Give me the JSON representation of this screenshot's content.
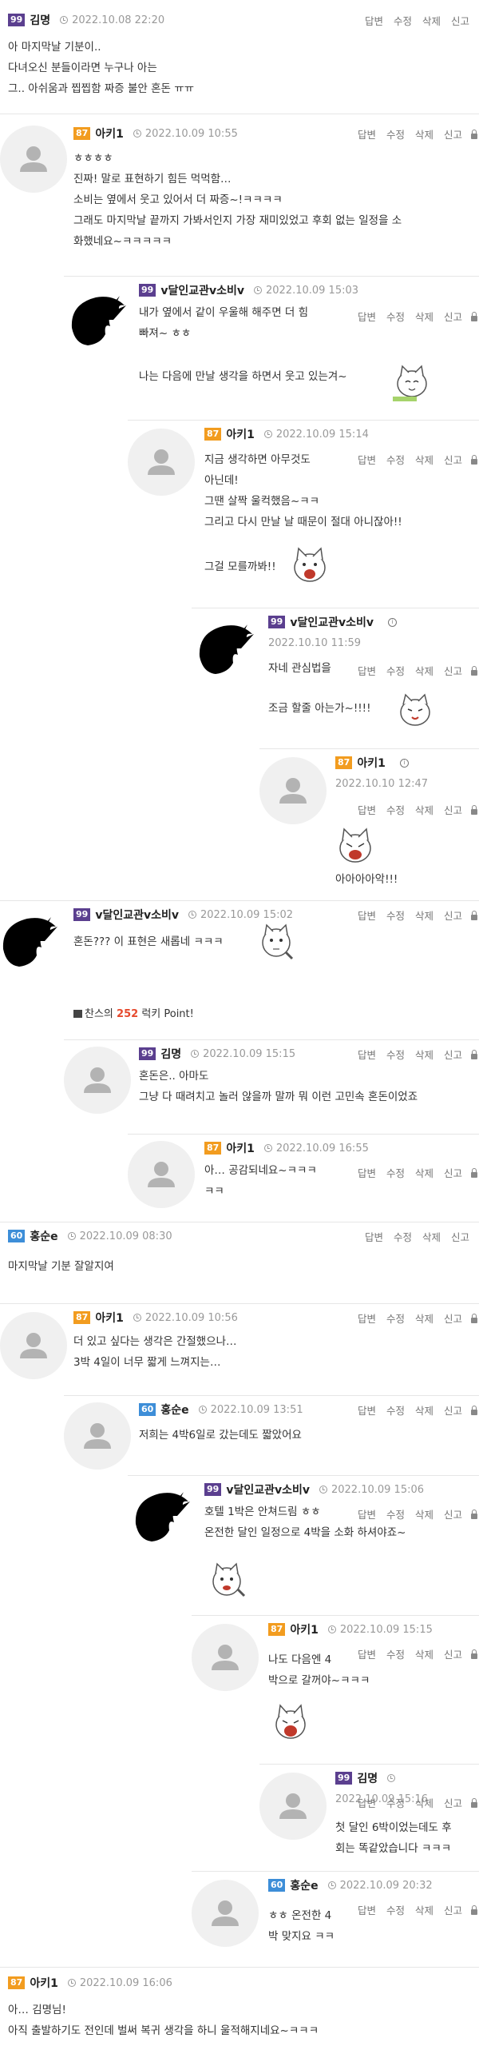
{
  "actions": {
    "reply": "답변",
    "edit": "수정",
    "delete": "삭제",
    "report": "신고"
  },
  "comments": [
    {
      "level": "99",
      "nick": "김명",
      "date": "2022.10.08 22:20",
      "text": "아 마지막날 기분이..\n다녀오신 분들이라면 누구나 아는\n그.. 아쉬움과 찝찝함 짜증 불안 혼돈 ㅠㅠ"
    },
    {
      "level": "87",
      "nick": "아키1",
      "date": "2022.10.09 10:55",
      "text": "ㅎㅎㅎㅎ\n진짜! 말로 표현하기 힘든 먹먹함…\n소비는 옆에서 웃고 있어서 더 짜증~!ㅋㅋㅋㅋ\n그래도 마지막날 끝까지 가봐서인지 가장 재미있었고 후회 없는 일정을 소\n화했네요~ㅋㅋㅋㅋㅋ"
    },
    {
      "level": "99",
      "nick": "v달인교관v소비v",
      "date": "2022.10.09 15:03",
      "text": "내가 옆에서 같이 우울해 해주면 더 힘\n빠져~ ㅎㅎ",
      "text2": "나는 다음에 만날 생각을 하면서 웃고 있는겨~"
    },
    {
      "level": "87",
      "nick": "아키1",
      "date": "2022.10.09 15:14",
      "text": "지금 생각하면 아무것도\n아닌데!\n그땐 살짝 울컥했음~ㅋㅋ\n그리고 다시 만날 날 때문이 절대 아니잖아!!",
      "text2": "그걸 모를까봐!!"
    },
    {
      "level": "99",
      "nick": "v달인교관v소비v",
      "date": "2022.10.10 11:59",
      "text": "자네 관심법을",
      "text2": "조금 할줄 아는가~!!!!"
    },
    {
      "level": "87",
      "nick": "아키1",
      "date": "2022.10.10 12:47",
      "text": "아아아아악!!!"
    },
    {
      "level": "99",
      "nick": "v달인교관v소비v",
      "date": "2022.10.09 15:02",
      "text": "혼돈??? 이 표현은 새롭네 ㅋㅋㅋ",
      "point_prefix": "찬스의",
      "point_value": "252",
      "point_suffix": "럭키 Point!"
    },
    {
      "level": "99",
      "nick": "김명",
      "date": "2022.10.09 15:15",
      "text": "혼돈은.. 아마도\n그냥 다 때려치고 놀러 않을까 말까 뭐 이런 고민속 혼돈이었죠"
    },
    {
      "level": "87",
      "nick": "아키1",
      "date": "2022.10.09 16:55",
      "text": "아… 공감되네요~ㅋㅋㅋ\nㅋㅋ"
    },
    {
      "level": "60",
      "nick": "홍순e",
      "date": "2022.10.09 08:30",
      "text": "마지막날 기분 잘알지여"
    },
    {
      "level": "87",
      "nick": "아키1",
      "date": "2022.10.09 10:56",
      "text": "더 있고 싶다는 생각은 간절했으나…\n3박 4일이 너무 짧게 느껴지는…"
    },
    {
      "level": "60",
      "nick": "홍순e",
      "date": "2022.10.09 13:51",
      "text": "저희는 4박6일로 갔는데도 짧았어요"
    },
    {
      "level": "99",
      "nick": "v달인교관v소비v",
      "date": "2022.10.09 15:06",
      "text": "호텔 1박은 안쳐드림 ㅎㅎ\n온전한 달인 일정으로 4박을 소화 하셔야죠~"
    },
    {
      "level": "87",
      "nick": "아키1",
      "date": "2022.10.09 15:15",
      "text": "나도 다음엔 4\n박으로 갈꺼야~ㅋㅋㅋ"
    },
    {
      "level": "99",
      "nick": "김명",
      "date": "2022.10.09 15:16",
      "text": "첫 달인 6박이었는데도 후\n회는 똑같았습니다 ㅋㅋㅋ"
    },
    {
      "level": "60",
      "nick": "홍순e",
      "date": "2022.10.09 20:32",
      "text": "ㅎㅎ 온전한 4\n박 맞지요 ㅋㅋ"
    },
    {
      "level": "87",
      "nick": "아키1",
      "date": "2022.10.09 16:06",
      "text": "아… 김명님!\n아직 출발하기도 전인데 벌써 복귀 생각을 하니 울적해지네요~ㅋㅋㅋ"
    }
  ]
}
